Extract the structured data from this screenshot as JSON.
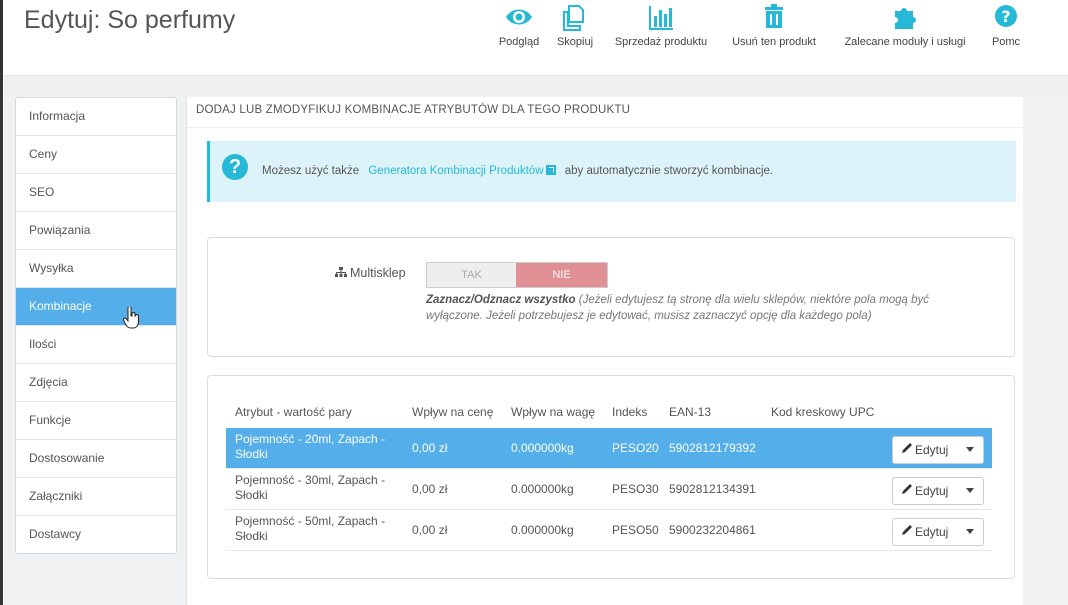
{
  "header": {
    "title": "Edytuj: So perfumy",
    "toolbar": [
      {
        "label": "Podgląd",
        "icon": "eye-icon"
      },
      {
        "label": "Skopiuj",
        "icon": "copy-icon"
      },
      {
        "label": "Sprzedaż produktu",
        "icon": "bar-chart-icon"
      },
      {
        "label": "Usuń ten produkt",
        "icon": "trash-icon"
      },
      {
        "label": "Zalecane moduły i usługi",
        "icon": "puzzle-icon"
      },
      {
        "label": "Pomc",
        "icon": "help-icon"
      }
    ]
  },
  "sidebar": {
    "items": [
      {
        "label": "Informacja"
      },
      {
        "label": "Ceny"
      },
      {
        "label": "SEO"
      },
      {
        "label": "Powiązania"
      },
      {
        "label": "Wysyłka"
      },
      {
        "label": "Kombinacje",
        "active": true
      },
      {
        "label": "Ilości"
      },
      {
        "label": "Zdjęcia"
      },
      {
        "label": "Funkcje"
      },
      {
        "label": "Dostosowanie"
      },
      {
        "label": "Załączniki"
      },
      {
        "label": "Dostawcy"
      }
    ]
  },
  "panel": {
    "heading": "DODAJ LUB ZMODYFIKUJ KOMBINACJE ATRYBUTÓW DLA TEGO PRODUKTU",
    "info": {
      "before": "Możesz użyć także",
      "link": "Generatora Kombinacji Produktów",
      "after": "aby automatycznie stworzyć kombinacje."
    },
    "multishop": {
      "label": "Multisklep",
      "yes": "TAK",
      "no": "NIE",
      "help_bold": "Zaznacz/Odznacz wszystko",
      "help_text": "(Jeżeli edytujesz tą stronę dla wielu sklepów, niektóre pola mogą być wyłączone. Jeżeli potrzebujesz je edytować, musisz zaznaczyć opcję dla każdego pola)"
    },
    "table": {
      "columns": [
        "Atrybut - wartość pary",
        "Wpływ na cenę",
        "Wpływ na wagę",
        "Indeks",
        "EAN-13",
        "Kod kreskowy UPC"
      ],
      "rows": [
        {
          "attr": "Pojemność - 20ml, Zapach - Słodki",
          "price": "0,00 zł",
          "weight": "0.000000kg",
          "ref": "PESO20",
          "ean": "5902812179392",
          "upc": "",
          "edit": "Edytuj"
        },
        {
          "attr": "Pojemność - 30ml, Zapach - Słodki",
          "price": "0,00 zł",
          "weight": "0.000000kg",
          "ref": "PESO30",
          "ean": "5902812134391",
          "upc": "",
          "edit": "Edytuj"
        },
        {
          "attr": "Pojemność - 50ml, Zapach - Słodki",
          "price": "0,00 zł",
          "weight": "0.000000kg",
          "ref": "PESO50",
          "ean": "5900232204861",
          "upc": "",
          "edit": "Edytuj"
        }
      ],
      "selected_row": 0
    }
  },
  "colors": {
    "accent": "#25b9d7",
    "selected": "#53aeea",
    "no_toggle": "#e08f95",
    "info_bg": "#dcf4f9"
  }
}
